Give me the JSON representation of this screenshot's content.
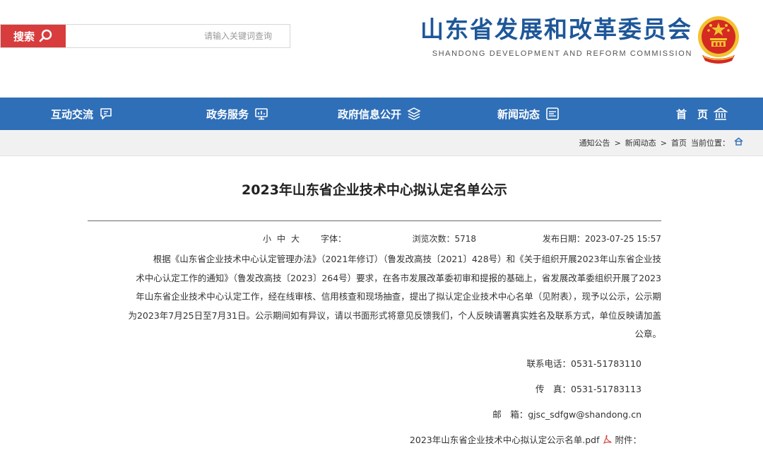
{
  "header": {
    "site_title": "山东省发展和改革委员会",
    "site_subtitle": "SHANDONG DEVELOPMENT AND REFORM COMMISSION",
    "search_button": "搜索",
    "search_placeholder": "请输入关键词查询"
  },
  "nav": {
    "items": [
      {
        "label": "首　页",
        "icon": "home-icon"
      },
      {
        "label": "新闻动态",
        "icon": "news-icon"
      },
      {
        "label": "政府信息公开",
        "icon": "layers-icon"
      },
      {
        "label": "政务服务",
        "icon": "monitor-icon"
      },
      {
        "label": "互动交流",
        "icon": "chat-icon"
      }
    ]
  },
  "breadcrumb": {
    "label": "当前位置：",
    "items": [
      "首页",
      "新闻动态",
      "通知公告"
    ],
    "separator": ">"
  },
  "article": {
    "title": "2023年山东省企业技术中心拟认定名单公示",
    "publish_date": "发布日期：2023-07-25 15:57",
    "views": "浏览次数：5718",
    "font_label": "字体：",
    "font_sizes": [
      "大",
      "中",
      "小"
    ],
    "paragraph_lines": [
      "根据《山东省企业技术中心认定管理办法》（2021年修订）（鲁发改高技〔2021〕428号）和《关于组织开展2023年山东省企业技",
      "术中心认定工作的通知》（鲁发改高技〔2023〕264号）要求，在各市发展改革委初审和提报的基础上，省发展改革委组织开展了2023",
      "年山东省企业技术中心认定工作，经在线审核、信用核查和现场抽查，提出了拟认定企业技术中心名单（见附表），现予以公示，公示期",
      "为2023年7月25日至7月31日。公示期间如有异议，请以书面形式将意见反馈我们，个人反映请署真实姓名及联系方式，单位反映请加盖",
      "公章。"
    ],
    "contact_phone": "联系电话：0531-51783110",
    "fax": "传　真：0531-51783113",
    "email": "邮　箱：gjsc_sdfgw@shandong.cn",
    "attachment_label": "附件：",
    "attachment_name": "2023年山东省企业技术中心拟认定公示名单.pdf"
  },
  "colors": {
    "brand_blue": "#1e5799",
    "nav_blue": "#2f6fb7",
    "search_red": "#d83c3c",
    "emblem_red": "#d42a22",
    "emblem_gold": "#f2c230"
  }
}
